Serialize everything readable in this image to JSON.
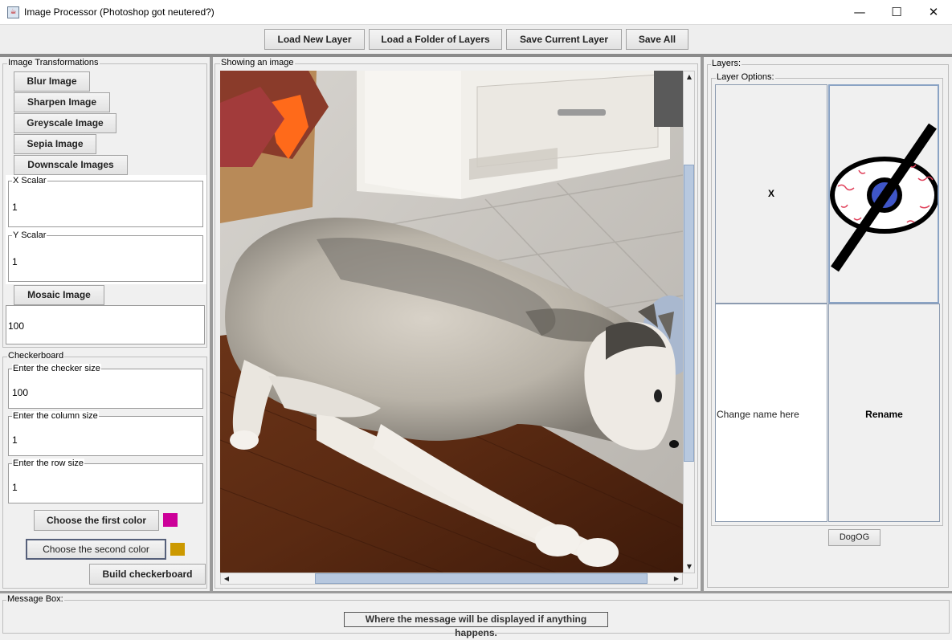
{
  "window": {
    "title": "Image Processor (Photoshop got neutered?)",
    "controls": [
      "—",
      "☐",
      "✕"
    ]
  },
  "toolbar": {
    "load_new_layer": "Load New Layer",
    "load_folder": "Load a Folder of Layers",
    "save_current": "Save Current Layer",
    "save_all": "Save All"
  },
  "transformations": {
    "title": "Image Transformations",
    "blur": "Blur Image",
    "sharpen": "Sharpen Image",
    "greyscale": "Greyscale Image",
    "sepia": "Sepia Image",
    "downscale": "Downscale Images",
    "x_scalar_label": "X Scalar",
    "x_scalar_value": "1",
    "y_scalar_label": "Y Scalar",
    "y_scalar_value": "1",
    "mosaic": "Mosaic Image",
    "mosaic_value": "100"
  },
  "checkerboard": {
    "title": "Checkerboard",
    "checker_size_label": "Enter the checker size",
    "checker_size_value": "100",
    "column_size_label": "Enter the column size",
    "column_size_value": "1",
    "row_size_label": "Enter the row size",
    "row_size_value": "1",
    "first_color_button": "Choose the first color",
    "first_color": "#cc0099",
    "second_color_button": "Choose the second color",
    "second_color": "#cc9900",
    "build_button": "Build checkerboard"
  },
  "viewer": {
    "title": "Showing an image",
    "image_icon": "husky-dog-photo"
  },
  "layers": {
    "title": "Layers:",
    "options_title": "Layer Options:",
    "delete_label": "X",
    "visibility_icon": "hidden-eye-icon",
    "name_placeholder": "Change name here",
    "rename_label": "Rename",
    "layer_name": "DogOG"
  },
  "message_box": {
    "title": "Message Box:",
    "message": "Where the message will be displayed if anything happens."
  }
}
